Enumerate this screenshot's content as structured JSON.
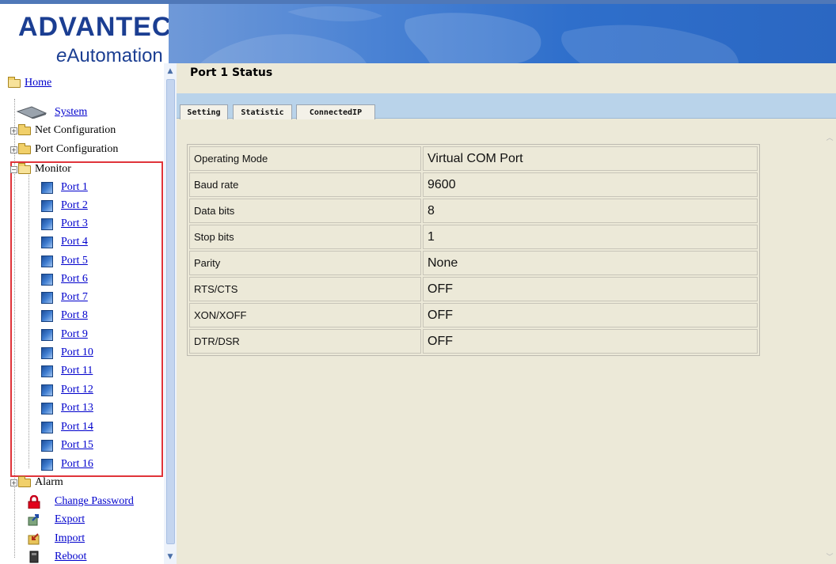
{
  "branding": {
    "logo_text": "ADVANTECH",
    "tagline_prefix": "e",
    "tagline_rest": "Automation"
  },
  "nav": {
    "home": "Home",
    "system": "System",
    "net_configuration": "Net Configuration",
    "port_configuration": "Port Configuration",
    "monitor": "Monitor",
    "ports": [
      "Port 1",
      "Port 2",
      "Port 3",
      "Port 4",
      "Port 5",
      "Port 6",
      "Port 7",
      "Port 8",
      "Port 9",
      "Port 10",
      "Port 11",
      "Port 12",
      "Port 13",
      "Port 14",
      "Port 15",
      "Port 16"
    ],
    "alarm": "Alarm",
    "change_password": "Change Password",
    "export": "Export",
    "import": "Import",
    "reboot": "Reboot"
  },
  "content": {
    "title": "Port 1 Status",
    "tabs": [
      "Setting",
      "Statistic",
      "ConnectedIP"
    ],
    "status_rows": [
      {
        "label": "Operating Mode",
        "value": "Virtual COM Port"
      },
      {
        "label": "Baud rate",
        "value": "9600"
      },
      {
        "label": "Data bits",
        "value": "8"
      },
      {
        "label": "Stop bits",
        "value": "1"
      },
      {
        "label": "Parity",
        "value": "None"
      },
      {
        "label": "RTS/CTS",
        "value": "OFF"
      },
      {
        "label": "XON/XOFF",
        "value": "OFF"
      },
      {
        "label": "DTR/DSR",
        "value": "OFF"
      }
    ]
  },
  "colors": {
    "brand": "#1b3e92",
    "banner": "#2f6fcb",
    "link": "#0000cc",
    "highlight_box": "#e0343a",
    "content_bg": "#ece9d8",
    "tabbar_bg": "#b9d3ea"
  },
  "icons": {
    "folder": "folder-icon",
    "folder_open": "folder-open-icon",
    "port": "port-monitor-icon",
    "system": "system-icon",
    "lock": "lock-icon",
    "export": "export-icon",
    "import": "import-icon",
    "reboot": "reboot-icon"
  }
}
